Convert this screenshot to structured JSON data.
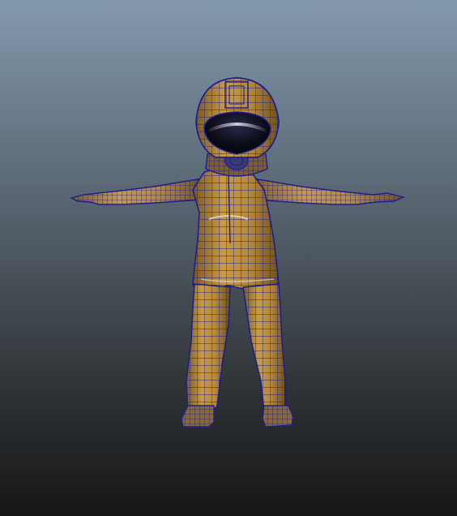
{
  "viewport": {
    "background_top": "#8399ad",
    "background_bottom": "#151617"
  },
  "model": {
    "surface_color": "#b58c3c",
    "wireframe_color": "#1c1e8e",
    "visor_color": "#0b0b18",
    "display_mode": "wireframe-on-shaded"
  }
}
